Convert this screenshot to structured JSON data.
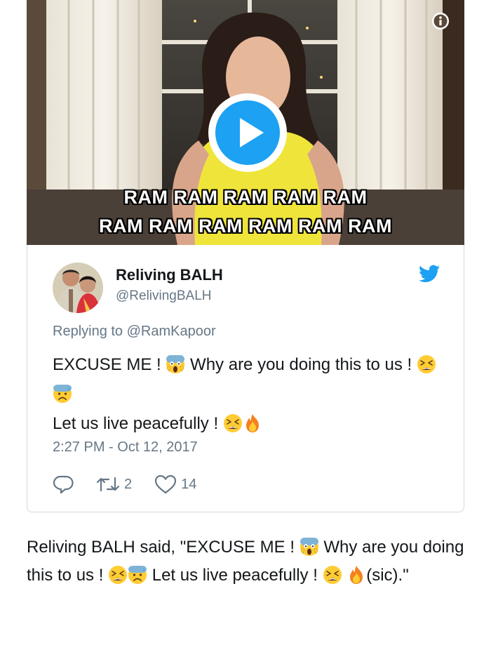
{
  "video": {
    "caption_line1": "RAM RAM RAM RAM RAM",
    "caption_line2": "RAM RAM RAM  RAM RAM RAM",
    "play_icon": "play-icon",
    "info_icon": "info-icon"
  },
  "tweet": {
    "display_name": "Reliving BALH",
    "handle": "@RelivingBALH",
    "replying_to": "Replying to @RamKapoor",
    "text_part1": "EXCUSE ME !",
    "text_part2": "Why are you doing this to us !",
    "text_part3": "Let us live peacefully !",
    "timestamp": "2:27 PM - Oct 12, 2017",
    "retweet_count": "2",
    "like_count": "14",
    "brand_color": "#1da1f2",
    "icons": [
      "reply-icon",
      "retweet-icon",
      "heart-icon",
      "twitter-bird-icon"
    ]
  },
  "article": {
    "part1": "Reliving BALH  said, \"EXCUSE ME !",
    "part2": "Why are you doing this to us !",
    "part3": "Let us live peacefully !",
    "part4": "(sic).\""
  }
}
